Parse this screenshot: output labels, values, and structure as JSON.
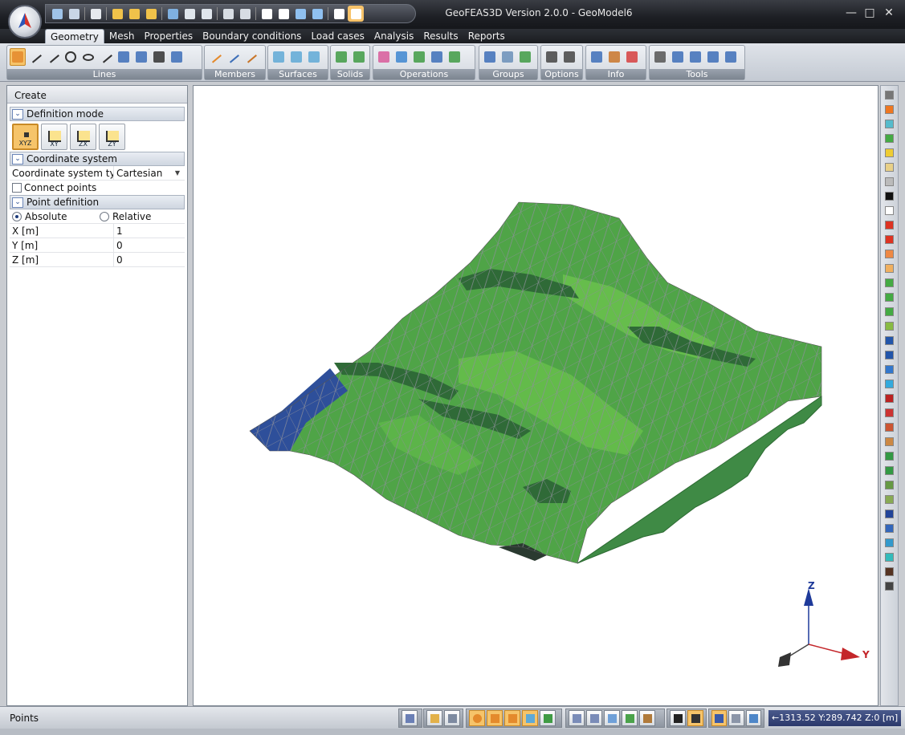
{
  "window": {
    "title": "GeoFEAS3D Version 2.0.0 - GeoModel6",
    "minimize_glyph": "—",
    "maximize_glyph": "□",
    "close_glyph": "✕"
  },
  "quick_access": [
    "open-icon",
    "save-icon",
    "sep",
    "check-icon",
    "sep",
    "sun-icon",
    "sun-icon",
    "sun-icon",
    "sep",
    "cube-icon",
    "node-icon",
    "node-icon",
    "sep",
    "camera-icon",
    "camera-icon",
    "sep",
    "zoom-icon",
    "zoom-window-icon",
    "pan-icon",
    "rotate-icon",
    "sep",
    "select-icon",
    "select-active-icon"
  ],
  "tabs": [
    "Geometry",
    "Mesh",
    "Properties",
    "Boundary conditions",
    "Load cases",
    "Analysis",
    "Results",
    "Reports"
  ],
  "active_tab": "Geometry",
  "ribbon_groups": [
    {
      "label": "Lines",
      "icons": [
        "point-icon",
        "line-icon",
        "arc-icon",
        "circle-icon",
        "ellipse-icon",
        "spline-icon",
        "divide-icon",
        "intersect-icon",
        "split-icon",
        "extend-icon"
      ]
    },
    {
      "label": "Members",
      "icons": [
        "member-icon",
        "member-delete-icon",
        "member-split-icon"
      ]
    },
    {
      "label": "Surfaces",
      "icons": [
        "surface-icon",
        "surface-loft-icon",
        "surface-sweep-icon"
      ]
    },
    {
      "label": "Solids",
      "icons": [
        "solid-box-icon",
        "solid-prism-icon"
      ]
    },
    {
      "label": "Operations",
      "icons": [
        "translate-icon",
        "copy-icon",
        "extrude-icon",
        "mirror-icon",
        "rotate-op-icon"
      ]
    },
    {
      "label": "Groups",
      "icons": [
        "group-icon",
        "group-add-icon",
        "group-remove-icon"
      ]
    },
    {
      "label": "Options",
      "icons": [
        "export-icon",
        "grid-icon"
      ]
    },
    {
      "label": "Info",
      "icons": [
        "measure-icon",
        "info-icon",
        "pen-icon"
      ]
    },
    {
      "label": "Tools",
      "icons": [
        "eraser-icon",
        "undo-icon",
        "redo-icon",
        "help-book-icon",
        "help-icon"
      ]
    }
  ],
  "panel": {
    "title": "Create",
    "definition_mode_label": "Definition mode",
    "modes": [
      "XYZ",
      "XY",
      "ZX",
      "ZY"
    ],
    "coordinate_system_label": "Coordinate system",
    "coord_type_key": "Coordinate system typ",
    "coord_type_value": "Cartesian",
    "connect_points_label": "Connect points",
    "point_definition_label": "Point definition",
    "absolute_label": "Absolute",
    "relative_label": "Relative",
    "fields": [
      {
        "label": "X  [m]",
        "value": "1"
      },
      {
        "label": "Y  [m]",
        "value": "0"
      },
      {
        "label": "Z  [m]",
        "value": "0"
      }
    ]
  },
  "viewport": {
    "axis_z_label": "Z",
    "axis_y_label": "Y"
  },
  "palette_colors": [
    "#777777",
    "#ee7722",
    "#55bbcc",
    "#44aa44",
    "#eecc33",
    "#e8d088",
    "#bbbbbb",
    "#111111",
    "#ffffff",
    "#dd3322",
    "#dd3322",
    "#ee8844",
    "#f0b060",
    "#44aa44",
    "#44aa44",
    "#44aa44",
    "#88bb44",
    "#2255aa",
    "#2255aa",
    "#3377cc",
    "#33aadd",
    "#bb2222",
    "#cc3333",
    "#cc5533",
    "#cc8844",
    "#339944",
    "#339944",
    "#669944",
    "#88aa55",
    "#224499",
    "#3366bb",
    "#3399cc",
    "#33bbbb",
    "#553322",
    "#444444"
  ],
  "status": {
    "mode_text": "Points",
    "coordinates": "←1313.52 Y:289.742 Z:0 [m]"
  }
}
